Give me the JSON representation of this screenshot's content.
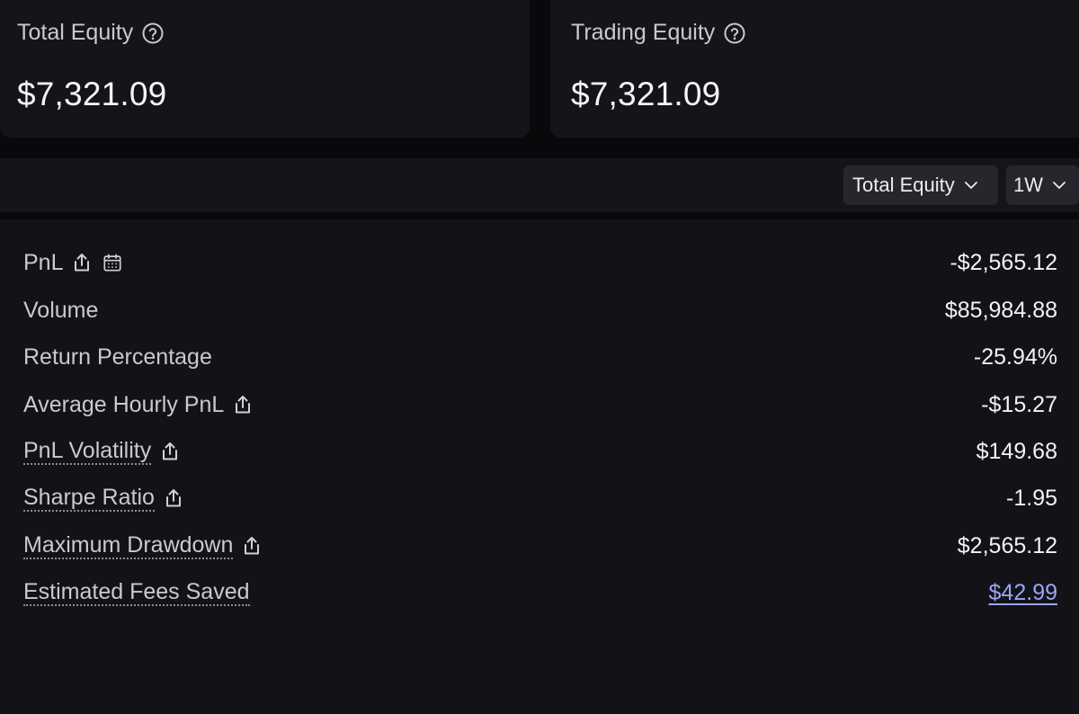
{
  "cards": {
    "total_equity": {
      "title": "Total Equity",
      "value": "$7,321.09",
      "icon": "help-circle-icon"
    },
    "trading_equity": {
      "title": "Trading Equity",
      "value": "$7,321.09",
      "icon": "help-circle-icon"
    }
  },
  "toolbar": {
    "metric_select": {
      "value": "Total Equity",
      "icon": "chevron-down-icon"
    },
    "range_select": {
      "value": "1W",
      "icon": "chevron-down-icon"
    }
  },
  "stats": [
    {
      "label": "PnL",
      "value": "-$2,565.12",
      "icons": [
        "share-icon",
        "calendar-icon"
      ]
    },
    {
      "label": "Volume",
      "value": "$85,984.88"
    },
    {
      "label": "Return Percentage",
      "value": "-25.94%"
    },
    {
      "label": "Average Hourly PnL",
      "value": "-$15.27",
      "icons": [
        "share-icon"
      ]
    },
    {
      "label": "PnL Volatility",
      "value": "$149.68",
      "icons": [
        "share-icon"
      ]
    },
    {
      "label": "Sharpe Ratio",
      "value": "-1.95",
      "icons": [
        "share-icon"
      ]
    },
    {
      "label": "Maximum Drawdown",
      "value": "$2,565.12",
      "icons": [
        "share-icon"
      ]
    },
    {
      "label": "Estimated Fees Saved",
      "value": "$42.99"
    }
  ],
  "colors": {
    "background": "#09090b",
    "card": "#151519",
    "link": "#9aa6f7"
  }
}
